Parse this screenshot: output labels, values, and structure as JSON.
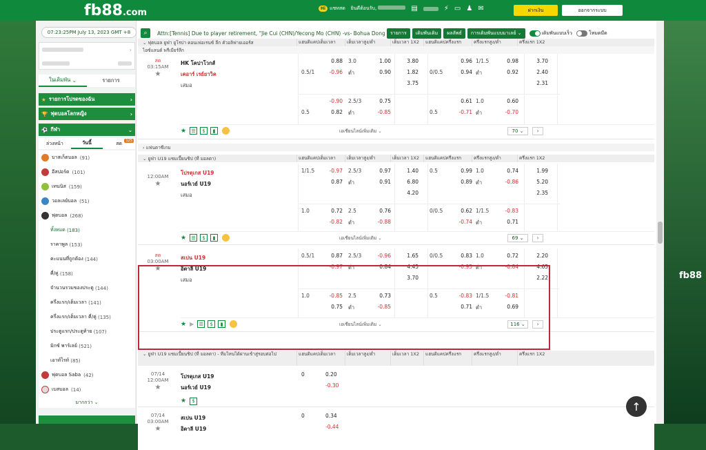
{
  "header": {
    "logo_main": "fb88",
    "logo_suffix": ".com",
    "chat_label": "แชทสด",
    "chat_badge": "Hi",
    "username_label": "ยินดีต้อนรับ,",
    "deposit": "ฝากเงิน",
    "logout": "ออกจากระบบ"
  },
  "sidebar": {
    "clock": "07:23:25PM July 13, 2023 GMT +8",
    "tabs": [
      "ในเดิมพัน",
      "รายการ"
    ],
    "menus": [
      "รายการโปรดของฉัน",
      "ฟุตบอลโลกหญิง",
      "กีฬา"
    ],
    "subtabs": [
      "ล่วงหน้า",
      "วันนี้",
      "สด"
    ],
    "live_badge": "125",
    "sports_top": [
      {
        "name": "บาสเก็ตบอล",
        "count": "(91)",
        "color": "#e07b2a"
      },
      {
        "name": "อีสปอร์ต",
        "count": "(101)",
        "color": "#c23b3b"
      },
      {
        "name": "เทนนิส",
        "count": "(159)",
        "color": "#8fc13a"
      },
      {
        "name": "วอลเลย์บอล",
        "count": "(51)",
        "color": "#3b87c2"
      },
      {
        "name": "ฟุตบอล",
        "count": "(268)",
        "color": "#333333"
      }
    ],
    "football_subs": [
      {
        "name": "ทั้งหมด",
        "count": "(183)"
      },
      {
        "name": "ราคาพูล",
        "count": "(153)"
      },
      {
        "name": "คะแนนที่ถูกต้อง",
        "count": "(144)"
      },
      {
        "name": "คี่/คู่",
        "count": "(158)"
      },
      {
        "name": "จำนวนรวมของประตู",
        "count": "(144)"
      },
      {
        "name": "ครึ่งแรก/เต็มเวลา",
        "count": "(141)"
      },
      {
        "name": "ครึ่งแรก/เต็มเวลา คี่/คู่",
        "count": "(135)"
      },
      {
        "name": "ประตูแรก/ประตูท้าย",
        "count": "(107)"
      },
      {
        "name": "มิกซ์ พาร์เลย์",
        "count": "(521)"
      },
      {
        "name": "เอาท์ไรท์",
        "count": "(85)"
      }
    ],
    "sports_bottom": [
      {
        "name": "ฟุตบอล Saba",
        "count": "(42)",
        "color": "#c23b3b"
      },
      {
        "name": "เบสบอล",
        "count": "(14)",
        "color": "#dddddd"
      }
    ],
    "more": "มากกว่า"
  },
  "ticker": {
    "text": "Attn:[Tennis] Due to player retirement, \"Jie Cui (CHN)/Yecong Mo (CHN) -vs- Bohua Dong",
    "buttons": [
      "รายการ",
      "เดิมพันเดิม",
      "ผลลัพธ์",
      "การเดิมพันแบบมาเลย์"
    ],
    "toggle1": "เดิมพันแบบเร็ว",
    "toggle2": "โหมดมืด"
  },
  "col_headers": [
    "แฮนดิแคปเต็มเวลา",
    "เต็มเวลาสูง/ต่ำ",
    "เต็มเวลา 1X2",
    "แฮนดิแคปครึ่งแรก",
    "ครึ่งแรกสูง/ต่ำ",
    "ครึ่งแรก 1X2"
  ],
  "leagues": {
    "l1": "ฟุตบอล ยูฟ่า ยูโรปา คอนเฟอเรนซ์ ลีก คัวอลิฟายเออร์ส",
    "l1b": "ไอซ์แลนด์ พรีเมียร์ลีก",
    "l2": "แฟนตาซีเกม",
    "l3": "ยูฟ่า U19 แชมเปี้ยนชิป (ที่ มอลตา)",
    "l4": "ยูฟ่า U19 แชมเปี้ยนชิป (ที่ มอลตา) - ทีมไหนได้ผ่านเข้าสู่รอบต่อไป"
  },
  "match1": {
    "status": "สด",
    "time": "03:15AM",
    "home": "HK โคปาโวกส์",
    "away": "เคอาร์ เรย์ยาวิค",
    "draw": "เสมอ",
    "r1": [
      "",
      "0.88",
      "3.0",
      "1.00",
      "3.80",
      "",
      "0.96",
      "1/1.5",
      "0.98",
      "3.70"
    ],
    "r2": [
      "0.5/1",
      "-0.96",
      "ต่ำ",
      "0.90",
      "1.82",
      "0/0.5",
      "0.94",
      "ต่ำ",
      "0.92",
      "2.40"
    ],
    "r3": [
      "",
      "",
      "",
      "",
      "3.75",
      "",
      "",
      "",
      "",
      "2.31"
    ],
    "r4": [
      "",
      "-0.90",
      "2.5/3",
      "0.75",
      "",
      "",
      "0.61",
      "1.0",
      "0.60",
      ""
    ],
    "r5": [
      "0.5",
      "0.82",
      "ต่ำ",
      "-0.85",
      "",
      "0.5",
      "-0.71",
      "ต่ำ",
      "-0.70",
      ""
    ],
    "more": "เอเชียนไลน์เพิ่มเติม",
    "count": "70"
  },
  "match2": {
    "status": "",
    "time": "12:00AM",
    "home": "โปรตุเกส U19",
    "away": "นอร์เวย์ U19",
    "draw": "เสมอ",
    "r1": [
      "1/1.5",
      "-0.97",
      "2.5/3",
      "0.97",
      "1.40",
      "0.5",
      "0.99",
      "1.0",
      "0.74",
      "1.99"
    ],
    "r2": [
      "",
      "0.87",
      "ต่ำ",
      "0.91",
      "6.80",
      "",
      "0.89",
      "ต่ำ",
      "-0.86",
      "5.20"
    ],
    "r3": [
      "",
      "",
      "",
      "",
      "4.20",
      "",
      "",
      "",
      "",
      "2.35"
    ],
    "r4": [
      "1.0",
      "0.72",
      "2.5",
      "0.76",
      "",
      "0/0.5",
      "0.62",
      "1/1.5",
      "-0.83",
      ""
    ],
    "r5": [
      "",
      "-0.82",
      "ต่ำ",
      "-0.88",
      "",
      "",
      "-0.74",
      "ต่ำ",
      "0.71",
      ""
    ],
    "more": "เอเชียนไลน์เพิ่มเติม",
    "count": "69"
  },
  "match3": {
    "status": "สด",
    "time": "03:00AM",
    "home": "สเปน U19",
    "away": "อิตาลี U19",
    "draw": "เสมอ",
    "r1": [
      "0.5/1",
      "0.87",
      "2.5/3",
      "-0.96",
      "1.65",
      "0/0.5",
      "0.83",
      "1.0",
      "0.72",
      "2.20"
    ],
    "r2": [
      "",
      "-0.97",
      "ต่ำ",
      "0.84",
      "4.45",
      "",
      "-0.95",
      "ต่ำ",
      "-0.84",
      "4.65"
    ],
    "r3": [
      "",
      "",
      "",
      "",
      "3.70",
      "",
      "",
      "",
      "",
      "2.22"
    ],
    "r4": [
      "1.0",
      "-0.85",
      "2.5",
      "0.73",
      "",
      "0.5",
      "-0.83",
      "1/1.5",
      "-0.81",
      ""
    ],
    "r5": [
      "",
      "0.75",
      "ต่ำ",
      "-0.85",
      "",
      "",
      "0.71",
      "ต่ำ",
      "0.69",
      ""
    ],
    "more": "เอเชียนไลน์เพิ่มเติม",
    "count": "116"
  },
  "match4": {
    "date": "07/14",
    "time": "12:00AM",
    "home": "โปรตุเกส U19",
    "away": "นอร์เวย์ U19",
    "line": "0",
    "o1": "0.20",
    "o2": "-0.30"
  },
  "match5": {
    "date": "07/14",
    "time": "03:00AM",
    "home": "สเปน U19",
    "away": "อิตาลี U19",
    "line": "0",
    "o1": "0.34",
    "o2": "-0.44"
  },
  "right_brand": "fb88"
}
